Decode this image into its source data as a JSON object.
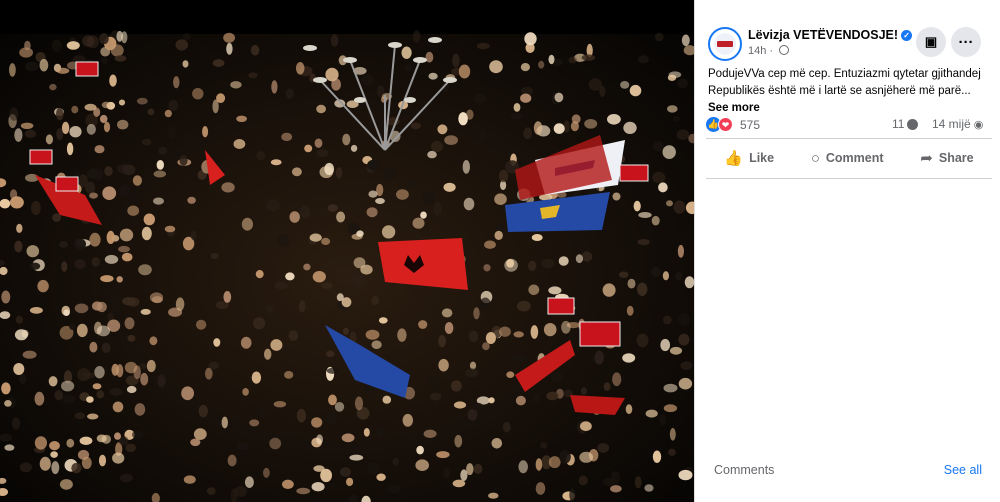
{
  "post": {
    "page_name": "Lëvizja VETËVENDOSJE!",
    "time": "14h",
    "text_line1": "PodujeVVa cep më cep. Entuziazmi qytetar gjithandej",
    "text_line2": "Republikës është më i lartë se asnjëherë më parë...",
    "see_more": "See more",
    "reaction_count": "575",
    "comment_count": "11",
    "view_count": "14 mijë",
    "icons": {
      "verified": "verified-badge-icon",
      "privacy": "globe-icon",
      "save": "bookmark-icon",
      "more": "more-options-icon"
    }
  },
  "actions": {
    "like": "Like",
    "comment": "Comment",
    "share": "Share"
  },
  "comments_section": {
    "label": "Comments",
    "see_all": "See all"
  },
  "colors": {
    "accent": "#1877f2",
    "love": "#f33e58",
    "flag_red": "#d8201e",
    "flag_blue": "#244aa5"
  }
}
